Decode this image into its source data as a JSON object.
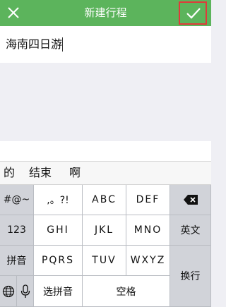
{
  "header": {
    "title": "新建行程",
    "close_icon": "close-icon",
    "confirm_icon": "checkmark-icon",
    "highlight_color": "#e03a3a",
    "bar_color": "#5cb45c"
  },
  "trip": {
    "name_value": "海南四日游"
  },
  "ime": {
    "candidates": [
      "的",
      "结束",
      "啊"
    ],
    "keys": {
      "symbols": "#@~",
      "punct": ",。?!",
      "abc": "ABC",
      "def": "DEF",
      "num": "123",
      "ghi": "GHI",
      "jkl": "JKL",
      "mno": "MNO",
      "english": "英文",
      "pinyin": "拼音",
      "pqrs": "PQRS",
      "tuv": "TUV",
      "wxyz": "WXYZ",
      "select_pinyin": "选拼音",
      "space": "空格",
      "newline": "换行"
    },
    "icons": {
      "backspace": "backspace-icon",
      "globe": "globe-icon",
      "mic": "microphone-icon"
    }
  }
}
